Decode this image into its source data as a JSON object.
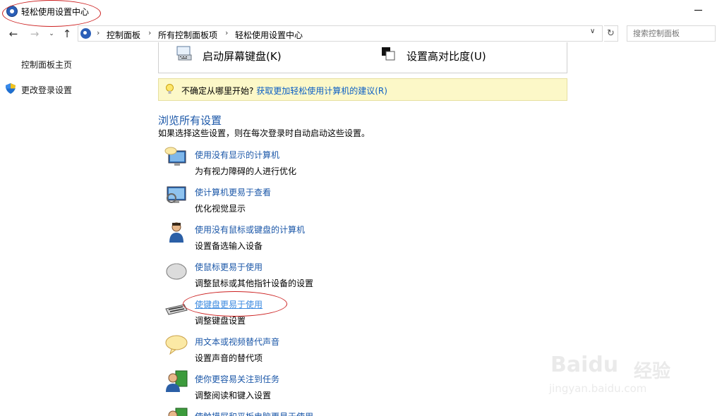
{
  "window": {
    "title": "轻松使用设置中心"
  },
  "address_bar": {
    "breadcrumbs": [
      "控制面板",
      "所有控制面板项",
      "轻松使用设置中心"
    ],
    "search_placeholder": "搜索控制面板"
  },
  "left_nav": {
    "home": "控制面板主页",
    "change_login": "更改登录设置"
  },
  "featured": {
    "osk": "启动屏幕键盘(K)",
    "high_contrast": "设置高对比度(U)"
  },
  "hint": {
    "text": "不确定从哪里开始?",
    "link": "获取更加轻松使用计算机的建议(R)"
  },
  "browse": {
    "title": "浏览所有设置",
    "subtitle": "如果选择这些设置，则在每次登录时自动启动这些设置。",
    "items": [
      {
        "title": "使用没有显示的计算机",
        "desc": "为有视力障碍的人进行优化",
        "icon": "speech-monitor-icon"
      },
      {
        "title": "使计算机更易于查看",
        "desc": "优化视觉显示",
        "icon": "magnifier-monitor-icon"
      },
      {
        "title": "使用没有鼠标或键盘的计算机",
        "desc": "设置备选输入设备",
        "icon": "user-icon"
      },
      {
        "title": "使鼠标更易于使用",
        "desc": "调整鼠标或其他指针设备的设置",
        "icon": "mouse-icon"
      },
      {
        "title": "使键盘更易于使用",
        "desc": "调整键盘设置",
        "icon": "keyboard-icon"
      },
      {
        "title": "用文本或视频替代声音",
        "desc": "设置声音的替代项",
        "icon": "speech-bubble-icon"
      },
      {
        "title": "使你更容易关注到任务",
        "desc": "调整阅读和键入设置",
        "icon": "user-document-icon"
      },
      {
        "title": "使触摸屏和平板电脑更易于使用",
        "desc": "",
        "icon": "touch-icon"
      }
    ]
  },
  "watermark": {
    "brand": "Baidu",
    "cn": "经验",
    "url": "jingyan.baidu.com"
  }
}
